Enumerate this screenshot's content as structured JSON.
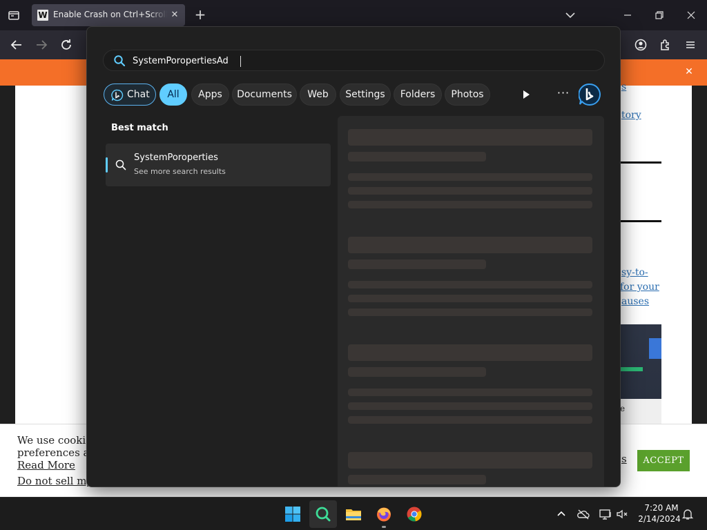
{
  "browser": {
    "tab_title": "Enable Crash on Ctrl+Scroll Lock",
    "tab_favicon_letter": "W",
    "tab_close": "✕",
    "new_tab": "+"
  },
  "page": {
    "links": [
      "s",
      "tory",
      "sy-to-",
      "for your",
      "auses"
    ],
    "orange_close": "✕",
    "thumb_char": "e",
    "cookie_line1": "We use cookie",
    "cookie_line2": "preferences ar",
    "cookie_read_more": "Read More",
    "cookie_do_not_sell": "Do not sell my",
    "cookie_settings_fragment": "s",
    "accept_label": "ACCEPT"
  },
  "search": {
    "query": "SystemPoropertiesAd",
    "filters": [
      "Chat",
      "All",
      "Apps",
      "Documents",
      "Web",
      "Settings",
      "Folders",
      "Photos"
    ],
    "active_filter": "All",
    "more_label": "···",
    "best_match_heading": "Best match",
    "result_title": "SystemPoroperties",
    "result_subtitle": "See more search results"
  },
  "taskbar": {
    "time": "7:20 AM",
    "date": "2/14/2024"
  },
  "colors": {
    "accent": "#60cdff",
    "orange_banner": "#f46f28",
    "accept_green": "#5aa02c",
    "panel_bg": "#202020"
  },
  "icons": {
    "search": "search-icon",
    "bing": "bing-icon",
    "play": "play-icon",
    "start": "windows-start-icon",
    "firefox": "firefox-icon",
    "chrome": "chrome-icon",
    "explorer": "folder-icon"
  }
}
